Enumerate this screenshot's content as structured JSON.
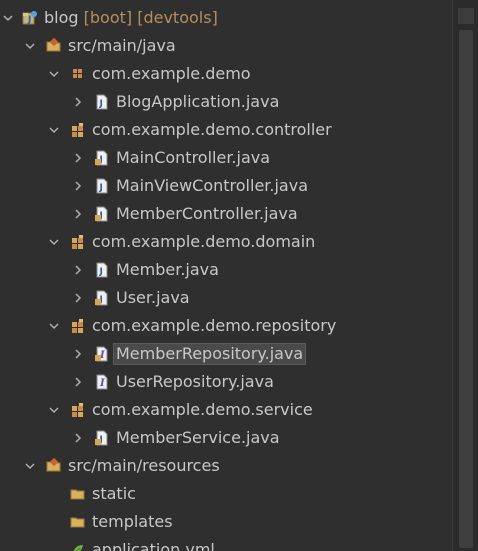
{
  "project": {
    "name": "blog",
    "decorations": "[boot] [devtools]"
  },
  "tree": {
    "src_main_java": "src/main/java",
    "pkg_demo": "com.example.demo",
    "blog_application": "BlogApplication.java",
    "pkg_controller": "com.example.demo.controller",
    "main_controller": "MainController.java",
    "main_view_controller": "MainViewController.java",
    "member_controller": "MemberController.java",
    "pkg_domain": "com.example.demo.domain",
    "member": "Member.java",
    "user": "User.java",
    "pkg_repository": "com.example.demo.repository",
    "member_repository": "MemberRepository.java",
    "user_repository": "UserRepository.java",
    "pkg_service": "com.example.demo.service",
    "member_service": "MemberService.java",
    "src_main_resources": "src/main/resources",
    "static": "static",
    "templates": "templates",
    "application_yml": "application.yml"
  },
  "icons": {
    "project": "project-icon",
    "source_folder": "source-folder-icon",
    "package_empty": "package-icon",
    "package": "package-icon",
    "java_class": "java-class-icon",
    "java_interface": "java-interface-icon",
    "folder": "folder-icon",
    "yml_file": "yml-file-icon"
  },
  "colors": {
    "background": "#2f2f2f",
    "text": "#c8c8c8",
    "decoration": "#b58f5c",
    "selection": "#4a4a4a"
  }
}
